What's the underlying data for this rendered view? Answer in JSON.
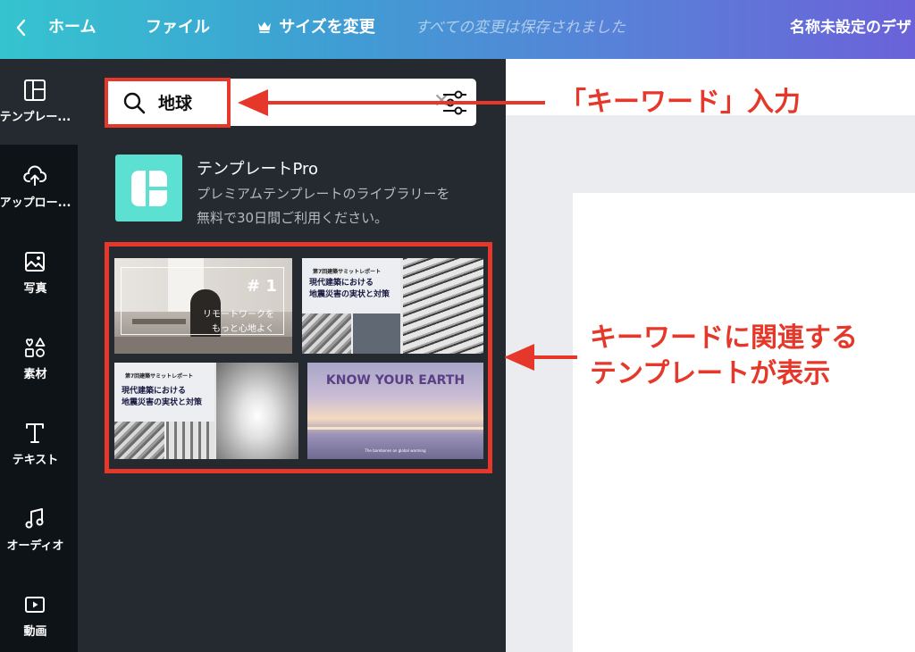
{
  "topbar": {
    "home": "ホーム",
    "file": "ファイル",
    "resize": "サイズを変更",
    "saved": "すべての変更は保存されました",
    "design_name": "名称未設定のデザ"
  },
  "rail": [
    {
      "label": "テンプレー...",
      "icon": "template-icon"
    },
    {
      "label": "アップロー...",
      "icon": "upload-icon"
    },
    {
      "label": "写真",
      "icon": "photo-icon"
    },
    {
      "label": "素材",
      "icon": "elements-icon"
    },
    {
      "label": "テキスト",
      "icon": "text-icon"
    },
    {
      "label": "オーディオ",
      "icon": "audio-icon"
    },
    {
      "label": "動画",
      "icon": "video-icon"
    }
  ],
  "search": {
    "value": "地球"
  },
  "pro": {
    "title": "テンプレートPro",
    "desc_line1": "プレミアムテンプレートのライブラリーを",
    "desc_line2": "無料で30日間ご利用ください。"
  },
  "templates": {
    "t1_num": "# 1",
    "t1_cap_line1": "リモートワークを",
    "t1_cap_line2": "もっと心地よく",
    "doc_top": "第7回建築サミットレポート",
    "doc_title_line1": "現代建築における",
    "doc_title_line2": "地震災害の実状と対策",
    "earth_title": "KNOW YOUR EARTH",
    "earth_sub": "The barebones on global warming"
  },
  "annotations": {
    "keyword": "「キーワード」入力",
    "related_line1": "キーワードに関連する",
    "related_line2": "テンプレートが表示"
  },
  "colors": {
    "accent_red": "#e5382a",
    "panel": "#252a31",
    "rail": "#0e1318",
    "pro_logo": "#5ce0d2"
  }
}
